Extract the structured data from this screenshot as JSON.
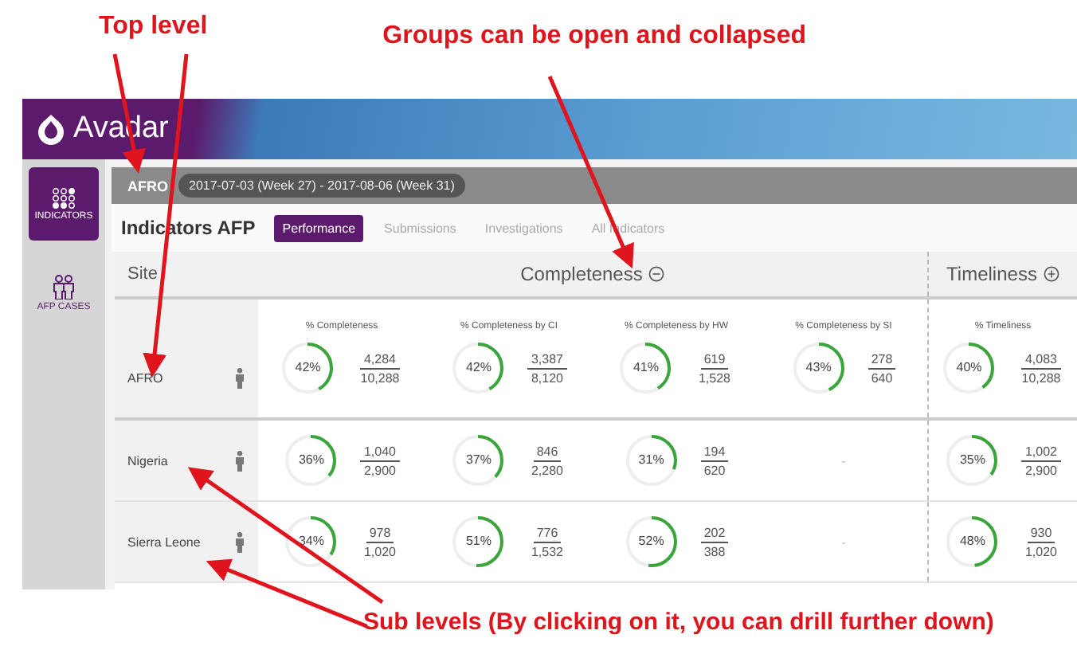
{
  "annotations": {
    "top": [
      {
        "text": "Top level"
      },
      {
        "text": "Groups can be open and collapsed"
      }
    ],
    "bottom": {
      "text": "Sub levels (By clicking on it, you can drill further down)"
    }
  },
  "app": {
    "name": "Avadar"
  },
  "sidebar": {
    "items": [
      {
        "label": "INDICATORS",
        "selected": true
      },
      {
        "label": "AFP CASES",
        "selected": false
      }
    ]
  },
  "breadcrumb": {
    "level": "AFRO",
    "period": "2017-07-03 (Week 27) - 2017-08-06 (Week 31)"
  },
  "page_title": "Indicators AFP",
  "tabs": [
    {
      "label": "Performance",
      "selected": true
    },
    {
      "label": "Submissions",
      "selected": false
    },
    {
      "label": "Investigations",
      "selected": false
    },
    {
      "label": "All Indicators",
      "selected": false
    }
  ],
  "table": {
    "site_header": "Site",
    "groups": [
      {
        "label": "Completeness",
        "expanded": true,
        "columns": [
          "% Completeness",
          "% Completeness by CI",
          "% Completeness by HW",
          "% Completeness by SI"
        ]
      },
      {
        "label": "Timeliness",
        "expanded": false,
        "columns": [
          "% Timeliness"
        ]
      }
    ],
    "rows": [
      {
        "site": "AFRO",
        "cells": [
          {
            "kind": "ring",
            "percent": "42%",
            "numerator": "4,284",
            "denominator": "10,288",
            "level": 0.42
          },
          {
            "kind": "ring",
            "percent": "42%",
            "numerator": "3,387",
            "denominator": "8,120",
            "level": 0.42
          },
          {
            "kind": "ring",
            "percent": "41%",
            "numerator": "619",
            "denominator": "1,528",
            "level": 0.41
          },
          {
            "kind": "ring",
            "percent": "43%",
            "numerator": "278",
            "denominator": "640",
            "level": 0.43
          },
          {
            "kind": "ring",
            "percent": "40%",
            "numerator": "4,083",
            "denominator": "10,288",
            "level": 0.4
          }
        ],
        "children": [
          {
            "site": "Nigeria",
            "cells": [
              {
                "kind": "ring",
                "percent": "36%",
                "numerator": "1,040",
                "denominator": "2,900",
                "level": 0.36
              },
              {
                "kind": "ring",
                "percent": "37%",
                "numerator": "846",
                "denominator": "2,280",
                "level": 0.37
              },
              {
                "kind": "ring",
                "percent": "31%",
                "numerator": "194",
                "denominator": "620",
                "level": 0.31
              },
              {
                "kind": "empty",
                "text": "-"
              },
              {
                "kind": "ring",
                "percent": "35%",
                "numerator": "1,002",
                "denominator": "2,900",
                "level": 0.35
              }
            ]
          },
          {
            "site": "Sierra Leone",
            "cells": [
              {
                "kind": "ring",
                "percent": "34%",
                "numerator": "978",
                "denominator": "1,020",
                "level": 0.34
              },
              {
                "kind": "ring",
                "percent": "51%",
                "numerator": "776",
                "denominator": "1,532",
                "level": 0.51
              },
              {
                "kind": "ring",
                "percent": "52%",
                "numerator": "202",
                "denominator": "388",
                "level": 0.52
              },
              {
                "kind": "empty",
                "text": "-"
              },
              {
                "kind": "ring",
                "percent": "48%",
                "numerator": "930",
                "denominator": "1,020",
                "level": 0.48
              }
            ]
          }
        ]
      }
    ]
  }
}
